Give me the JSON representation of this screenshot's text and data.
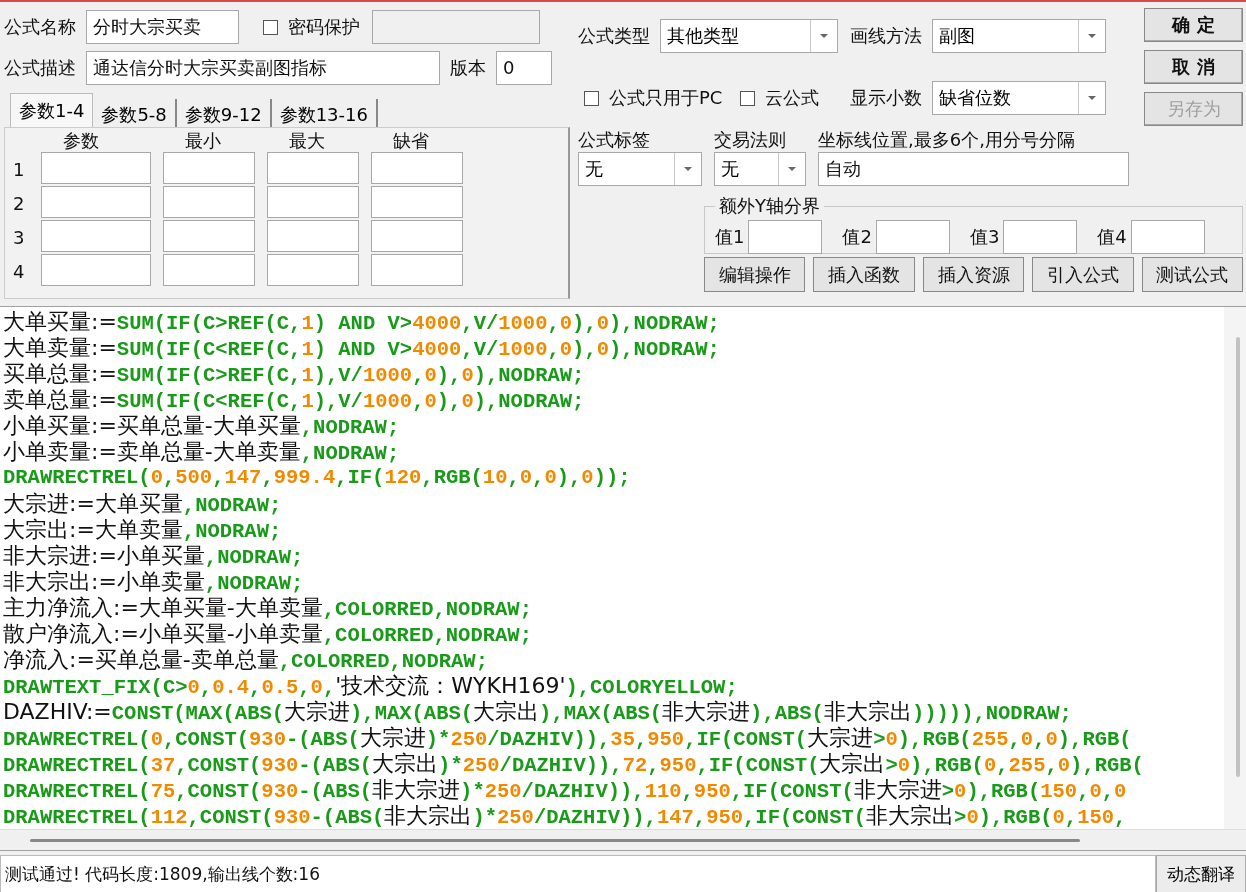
{
  "formula_name": {
    "label": "公式名称",
    "value": "分时大宗买卖"
  },
  "password": {
    "label": "密码保护",
    "checked": false
  },
  "description": {
    "label": "公式描述",
    "value": "通达信分时大宗买卖副图指标"
  },
  "version": {
    "label": "版本",
    "value": "0"
  },
  "formula_type": {
    "label": "公式类型",
    "value": "其他类型"
  },
  "draw_method": {
    "label": "画线方法",
    "value": "副图"
  },
  "options": [
    {
      "label": "公式只用于PC",
      "checked": false
    },
    {
      "label": "云公式",
      "checked": false
    }
  ],
  "decimals": {
    "label": "显示小数",
    "value": "缺省位数"
  },
  "action_buttons": [
    {
      "label": "确 定",
      "disabled": false
    },
    {
      "label": "取 消",
      "disabled": false
    },
    {
      "label": "另存为",
      "disabled": true
    }
  ],
  "param_tabs": [
    {
      "label": "参数1-4",
      "selected": true
    },
    {
      "label": "参数5-8",
      "selected": false
    },
    {
      "label": "参数9-12",
      "selected": false
    },
    {
      "label": "参数13-16",
      "selected": false
    }
  ],
  "param_table": {
    "columns": [
      "参数",
      "最小",
      "最大",
      "缺省"
    ],
    "rows": [
      "1",
      "2",
      "3",
      "4"
    ]
  },
  "formula_tag": {
    "label": "公式标签",
    "value": "无"
  },
  "trade_rule": {
    "label": "交易法则",
    "value": "无"
  },
  "axis_lines": {
    "label": "坐标线位置,最多6个,用分号分隔",
    "value": "自动"
  },
  "extra_y": {
    "title": "额外Y轴分界",
    "fields": [
      "值1",
      "值2",
      "值3",
      "值4"
    ]
  },
  "tool_buttons": [
    "编辑操作",
    "插入函数",
    "插入资源",
    "引入公式",
    "测试公式"
  ],
  "code_lines": [
    [
      {
        "kind": "ident",
        "text": "大单买量:="
      },
      {
        "kind": "code",
        "text": "SUM(IF(C>REF(C,"
      },
      {
        "kind": "num",
        "text": "1"
      },
      {
        "kind": "code",
        "text": ") AND V>"
      },
      {
        "kind": "num",
        "text": "4000"
      },
      {
        "kind": "code",
        "text": ",V/"
      },
      {
        "kind": "num",
        "text": "1000"
      },
      {
        "kind": "code",
        "text": ","
      },
      {
        "kind": "num",
        "text": "0"
      },
      {
        "kind": "code",
        "text": "),"
      },
      {
        "kind": "num",
        "text": "0"
      },
      {
        "kind": "code",
        "text": "),NODRAW;"
      }
    ],
    [
      {
        "kind": "ident",
        "text": "大单卖量:="
      },
      {
        "kind": "code",
        "text": "SUM(IF(C<REF(C,"
      },
      {
        "kind": "num",
        "text": "1"
      },
      {
        "kind": "code",
        "text": ") AND V>"
      },
      {
        "kind": "num",
        "text": "4000"
      },
      {
        "kind": "code",
        "text": ",V/"
      },
      {
        "kind": "num",
        "text": "1000"
      },
      {
        "kind": "code",
        "text": ","
      },
      {
        "kind": "num",
        "text": "0"
      },
      {
        "kind": "code",
        "text": "),"
      },
      {
        "kind": "num",
        "text": "0"
      },
      {
        "kind": "code",
        "text": "),NODRAW;"
      }
    ],
    [
      {
        "kind": "ident",
        "text": "买单总量:="
      },
      {
        "kind": "code",
        "text": "SUM(IF(C>REF(C,"
      },
      {
        "kind": "num",
        "text": "1"
      },
      {
        "kind": "code",
        "text": "),V/"
      },
      {
        "kind": "num",
        "text": "1000"
      },
      {
        "kind": "code",
        "text": ","
      },
      {
        "kind": "num",
        "text": "0"
      },
      {
        "kind": "code",
        "text": "),"
      },
      {
        "kind": "num",
        "text": "0"
      },
      {
        "kind": "code",
        "text": "),NODRAW;"
      }
    ],
    [
      {
        "kind": "ident",
        "text": "卖单总量:="
      },
      {
        "kind": "code",
        "text": "SUM(IF(C<REF(C,"
      },
      {
        "kind": "num",
        "text": "1"
      },
      {
        "kind": "code",
        "text": "),V/"
      },
      {
        "kind": "num",
        "text": "1000"
      },
      {
        "kind": "code",
        "text": ","
      },
      {
        "kind": "num",
        "text": "0"
      },
      {
        "kind": "code",
        "text": "),"
      },
      {
        "kind": "num",
        "text": "0"
      },
      {
        "kind": "code",
        "text": "),NODRAW;"
      }
    ],
    [
      {
        "kind": "ident",
        "text": "小单买量:=买单总量-大单买量"
      },
      {
        "kind": "code",
        "text": ",NODRAW;"
      }
    ],
    [
      {
        "kind": "ident",
        "text": "小单卖量:=卖单总量-大单卖量"
      },
      {
        "kind": "code",
        "text": ",NODRAW;"
      }
    ],
    [
      {
        "kind": "code",
        "text": "DRAWRECTREL("
      },
      {
        "kind": "num",
        "text": "0"
      },
      {
        "kind": "code",
        "text": ","
      },
      {
        "kind": "num",
        "text": "500"
      },
      {
        "kind": "code",
        "text": ","
      },
      {
        "kind": "num",
        "text": "147"
      },
      {
        "kind": "code",
        "text": ","
      },
      {
        "kind": "num",
        "text": "999.4"
      },
      {
        "kind": "code",
        "text": ",IF("
      },
      {
        "kind": "num",
        "text": "120"
      },
      {
        "kind": "code",
        "text": ",RGB("
      },
      {
        "kind": "num",
        "text": "10"
      },
      {
        "kind": "code",
        "text": ","
      },
      {
        "kind": "num",
        "text": "0"
      },
      {
        "kind": "code",
        "text": ","
      },
      {
        "kind": "num",
        "text": "0"
      },
      {
        "kind": "code",
        "text": "),"
      },
      {
        "kind": "num",
        "text": "0"
      },
      {
        "kind": "code",
        "text": "));"
      }
    ],
    [
      {
        "kind": "ident",
        "text": "大宗进:=大单买量"
      },
      {
        "kind": "code",
        "text": ",NODRAW;"
      }
    ],
    [
      {
        "kind": "ident",
        "text": "大宗出:=大单卖量"
      },
      {
        "kind": "code",
        "text": ",NODRAW;"
      }
    ],
    [
      {
        "kind": "ident",
        "text": "非大宗进:=小单买量"
      },
      {
        "kind": "code",
        "text": ",NODRAW;"
      }
    ],
    [
      {
        "kind": "ident",
        "text": "非大宗出:=小单卖量"
      },
      {
        "kind": "code",
        "text": ",NODRAW;"
      }
    ],
    [
      {
        "kind": "ident",
        "text": "主力净流入:=大单买量-大单卖量"
      },
      {
        "kind": "code",
        "text": ",COLORRED,NODRAW;"
      }
    ],
    [
      {
        "kind": "ident",
        "text": "散户净流入:=小单买量-小单卖量"
      },
      {
        "kind": "code",
        "text": ",COLORRED,NODRAW;"
      }
    ],
    [
      {
        "kind": "ident",
        "text": "净流入:=买单总量-卖单总量"
      },
      {
        "kind": "code",
        "text": ",COLORRED,NODRAW;"
      }
    ],
    [
      {
        "kind": "code",
        "text": "DRAWTEXT_FIX(C>"
      },
      {
        "kind": "num",
        "text": "0"
      },
      {
        "kind": "code",
        "text": ","
      },
      {
        "kind": "num",
        "text": "0.4"
      },
      {
        "kind": "code",
        "text": ","
      },
      {
        "kind": "num",
        "text": "0.5"
      },
      {
        "kind": "code",
        "text": ","
      },
      {
        "kind": "num",
        "text": "0"
      },
      {
        "kind": "code",
        "text": ","
      },
      {
        "kind": "ident",
        "text": "'技术交流：WYKH169'"
      },
      {
        "kind": "code",
        "text": "),COLORYELLOW;"
      }
    ],
    [
      {
        "kind": "ident",
        "text": "DAZHIV:="
      },
      {
        "kind": "code",
        "text": "CONST(MAX(ABS("
      },
      {
        "kind": "ident",
        "text": "大宗进"
      },
      {
        "kind": "code",
        "text": "),MAX(ABS("
      },
      {
        "kind": "ident",
        "text": "大宗出"
      },
      {
        "kind": "code",
        "text": "),MAX(ABS("
      },
      {
        "kind": "ident",
        "text": "非大宗进"
      },
      {
        "kind": "code",
        "text": "),ABS("
      },
      {
        "kind": "ident",
        "text": "非大宗出"
      },
      {
        "kind": "code",
        "text": "))))),NODRAW;"
      }
    ],
    [
      {
        "kind": "code",
        "text": "DRAWRECTREL("
      },
      {
        "kind": "num",
        "text": "0"
      },
      {
        "kind": "code",
        "text": ",CONST("
      },
      {
        "kind": "num",
        "text": "930"
      },
      {
        "kind": "code",
        "text": "-(ABS("
      },
      {
        "kind": "ident",
        "text": "大宗进"
      },
      {
        "kind": "code",
        "text": ")*"
      },
      {
        "kind": "num",
        "text": "250"
      },
      {
        "kind": "code",
        "text": "/DAZHIV)),"
      },
      {
        "kind": "num",
        "text": "35"
      },
      {
        "kind": "code",
        "text": ","
      },
      {
        "kind": "num",
        "text": "950"
      },
      {
        "kind": "code",
        "text": ",IF(CONST("
      },
      {
        "kind": "ident",
        "text": "大宗进"
      },
      {
        "kind": "code",
        "text": ">"
      },
      {
        "kind": "num",
        "text": "0"
      },
      {
        "kind": "code",
        "text": "),RGB("
      },
      {
        "kind": "num",
        "text": "255"
      },
      {
        "kind": "code",
        "text": ","
      },
      {
        "kind": "num",
        "text": "0"
      },
      {
        "kind": "code",
        "text": ","
      },
      {
        "kind": "num",
        "text": "0"
      },
      {
        "kind": "code",
        "text": "),RGB("
      }
    ],
    [
      {
        "kind": "code",
        "text": "DRAWRECTREL("
      },
      {
        "kind": "num",
        "text": "37"
      },
      {
        "kind": "code",
        "text": ",CONST("
      },
      {
        "kind": "num",
        "text": "930"
      },
      {
        "kind": "code",
        "text": "-(ABS("
      },
      {
        "kind": "ident",
        "text": "大宗出"
      },
      {
        "kind": "code",
        "text": ")*"
      },
      {
        "kind": "num",
        "text": "250"
      },
      {
        "kind": "code",
        "text": "/DAZHIV)),"
      },
      {
        "kind": "num",
        "text": "72"
      },
      {
        "kind": "code",
        "text": ","
      },
      {
        "kind": "num",
        "text": "950"
      },
      {
        "kind": "code",
        "text": ",IF(CONST("
      },
      {
        "kind": "ident",
        "text": "大宗出"
      },
      {
        "kind": "code",
        "text": ">"
      },
      {
        "kind": "num",
        "text": "0"
      },
      {
        "kind": "code",
        "text": "),RGB("
      },
      {
        "kind": "num",
        "text": "0"
      },
      {
        "kind": "code",
        "text": ","
      },
      {
        "kind": "num",
        "text": "255"
      },
      {
        "kind": "code",
        "text": ","
      },
      {
        "kind": "num",
        "text": "0"
      },
      {
        "kind": "code",
        "text": "),RGB("
      }
    ],
    [
      {
        "kind": "code",
        "text": "DRAWRECTREL("
      },
      {
        "kind": "num",
        "text": "75"
      },
      {
        "kind": "code",
        "text": ",CONST("
      },
      {
        "kind": "num",
        "text": "930"
      },
      {
        "kind": "code",
        "text": "-(ABS("
      },
      {
        "kind": "ident",
        "text": "非大宗进"
      },
      {
        "kind": "code",
        "text": ")*"
      },
      {
        "kind": "num",
        "text": "250"
      },
      {
        "kind": "code",
        "text": "/DAZHIV)),"
      },
      {
        "kind": "num",
        "text": "110"
      },
      {
        "kind": "code",
        "text": ","
      },
      {
        "kind": "num",
        "text": "950"
      },
      {
        "kind": "code",
        "text": ",IF(CONST("
      },
      {
        "kind": "ident",
        "text": "非大宗进"
      },
      {
        "kind": "code",
        "text": ">"
      },
      {
        "kind": "num",
        "text": "0"
      },
      {
        "kind": "code",
        "text": "),RGB("
      },
      {
        "kind": "num",
        "text": "150"
      },
      {
        "kind": "code",
        "text": ","
      },
      {
        "kind": "num",
        "text": "0"
      },
      {
        "kind": "code",
        "text": ","
      },
      {
        "kind": "num",
        "text": "0"
      }
    ],
    [
      {
        "kind": "code",
        "text": "DRAWRECTREL("
      },
      {
        "kind": "num",
        "text": "112"
      },
      {
        "kind": "code",
        "text": ",CONST("
      },
      {
        "kind": "num",
        "text": "930"
      },
      {
        "kind": "code",
        "text": "-(ABS("
      },
      {
        "kind": "ident",
        "text": "非大宗出"
      },
      {
        "kind": "code",
        "text": ")*"
      },
      {
        "kind": "num",
        "text": "250"
      },
      {
        "kind": "code",
        "text": "/DAZHIV)),"
      },
      {
        "kind": "num",
        "text": "147"
      },
      {
        "kind": "code",
        "text": ","
      },
      {
        "kind": "num",
        "text": "950"
      },
      {
        "kind": "code",
        "text": ",IF(CONST("
      },
      {
        "kind": "ident",
        "text": "非大宗出"
      },
      {
        "kind": "code",
        "text": ">"
      },
      {
        "kind": "num",
        "text": "0"
      },
      {
        "kind": "code",
        "text": "),RGB("
      },
      {
        "kind": "num",
        "text": "0"
      },
      {
        "kind": "code",
        "text": ","
      },
      {
        "kind": "num",
        "text": "150"
      },
      {
        "kind": "code",
        "text": ","
      }
    ]
  ],
  "status": {
    "message": "测试通过! 代码长度:1809,输出线个数:16",
    "button": "动态翻译"
  }
}
